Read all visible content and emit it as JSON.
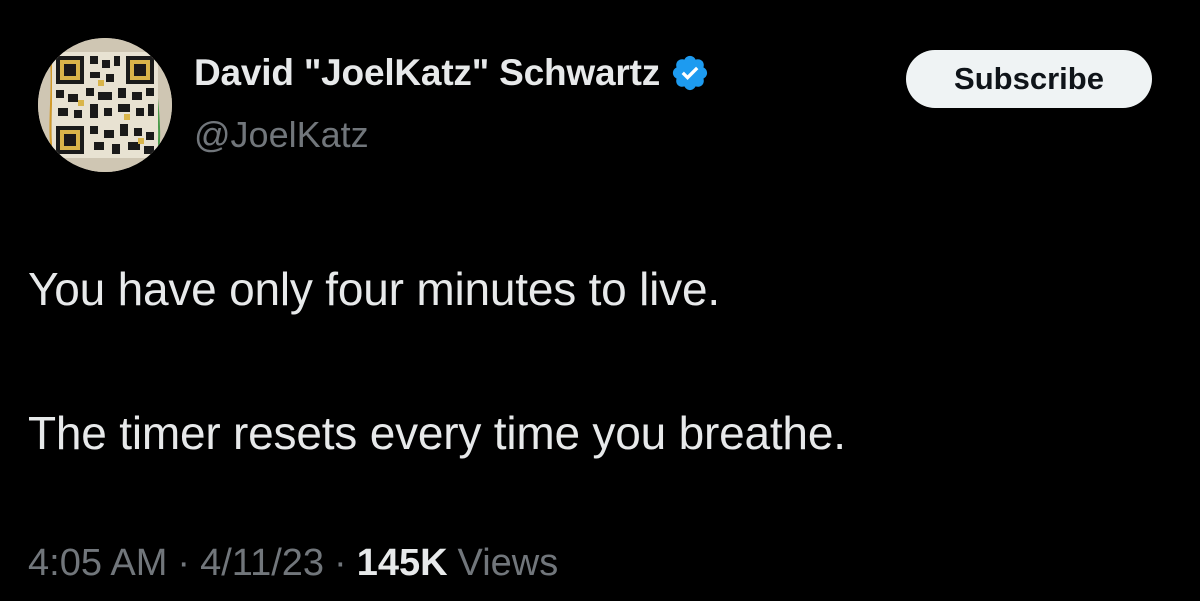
{
  "author": {
    "display_name": "David \"JoelKatz\" Schwartz",
    "handle": "@JoelKatz",
    "verified": true,
    "verified_icon": "verified-badge-icon",
    "verified_color": "#1d9bf0",
    "avatar": "qr-code-avatar"
  },
  "actions": {
    "subscribe_label": "Subscribe"
  },
  "tweet": {
    "line1": "You have only four minutes to live.",
    "line2": "The timer resets every time you breathe."
  },
  "meta": {
    "time": "4:05 AM",
    "separator": "·",
    "date": "4/11/23",
    "views_count": "145K",
    "views_label": "Views"
  },
  "colors": {
    "background": "#000000",
    "primary_text": "#e7e9ea",
    "secondary_text": "#71767b",
    "button_bg": "#eff3f4",
    "button_text": "#0f1419"
  }
}
